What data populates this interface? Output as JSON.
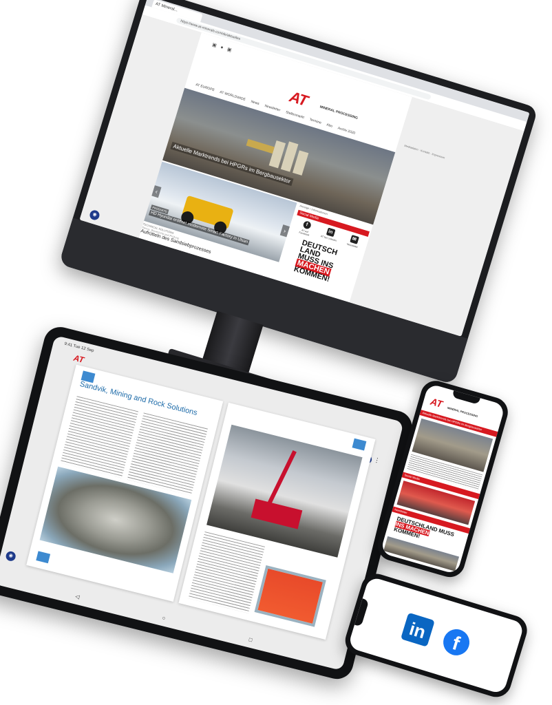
{
  "desktop": {
    "browser_tab": "AT Mineral...",
    "url": "https://www.at-minerals.com/de/aktuelles",
    "logo": "AT",
    "logo_sub": "MINERAL PROCESSING",
    "nav": [
      "AT EUROPE",
      "AT WORLDWIDE",
      "News",
      "Newsletter",
      "Stellenmarkt",
      "Termine",
      "Abo",
      "Archiv 2020"
    ],
    "header_links": "Mediadaten · Kontakt · Impressum",
    "hero_caption": "Aktuelle Marktrends bei HPGRs im Bergbausektor",
    "slide_tag": "PRODUKTE",
    "slide_title": "HD Hyundai eröffnet modernste Smart-Factory in Ulsan",
    "article_category": "TECHNICAL SOLUTIONS",
    "article_sub": "Sterne, Bewertung und Prüfung",
    "article_title": "Aufrütteln des Sandsiebprozesses",
    "sidebar_label": "Anzeige / Informationen",
    "social_header": "Social Media",
    "social": [
      {
        "icon": "facebook-icon",
        "glyph": "f",
        "label": "AT auf Facebook"
      },
      {
        "icon": "linkedin-icon",
        "glyph": "in",
        "label": "AT bei LinkedIn"
      },
      {
        "icon": "newsletter-icon",
        "glyph": "✉",
        "label": "Newsletter"
      }
    ],
    "banner_lines": [
      "DEUTSCH",
      "LAND",
      "MUSS INS",
      "MACHEN",
      "KOMMEN!"
    ]
  },
  "tablet": {
    "status": "9:41  Tue 12 Sep",
    "logo": "AT",
    "article_title": "Sandvik, Mining and Rock Solutions",
    "nav_icons": [
      "◁",
      "○",
      "□"
    ]
  },
  "phone1": {
    "logo": "AT",
    "logo_sub": "MINERAL PROCESSING",
    "bar1": "Aktuelle Markttrends bei HPGRs im Bergbausektor",
    "bar2": "Social Media",
    "bar3": "Newsletter",
    "banner": [
      "DEUTSCHLAND MUSS",
      "INS MACHEN",
      "KOMMEN!"
    ]
  },
  "phone2": {
    "linkedin": "in",
    "facebook": "f"
  }
}
